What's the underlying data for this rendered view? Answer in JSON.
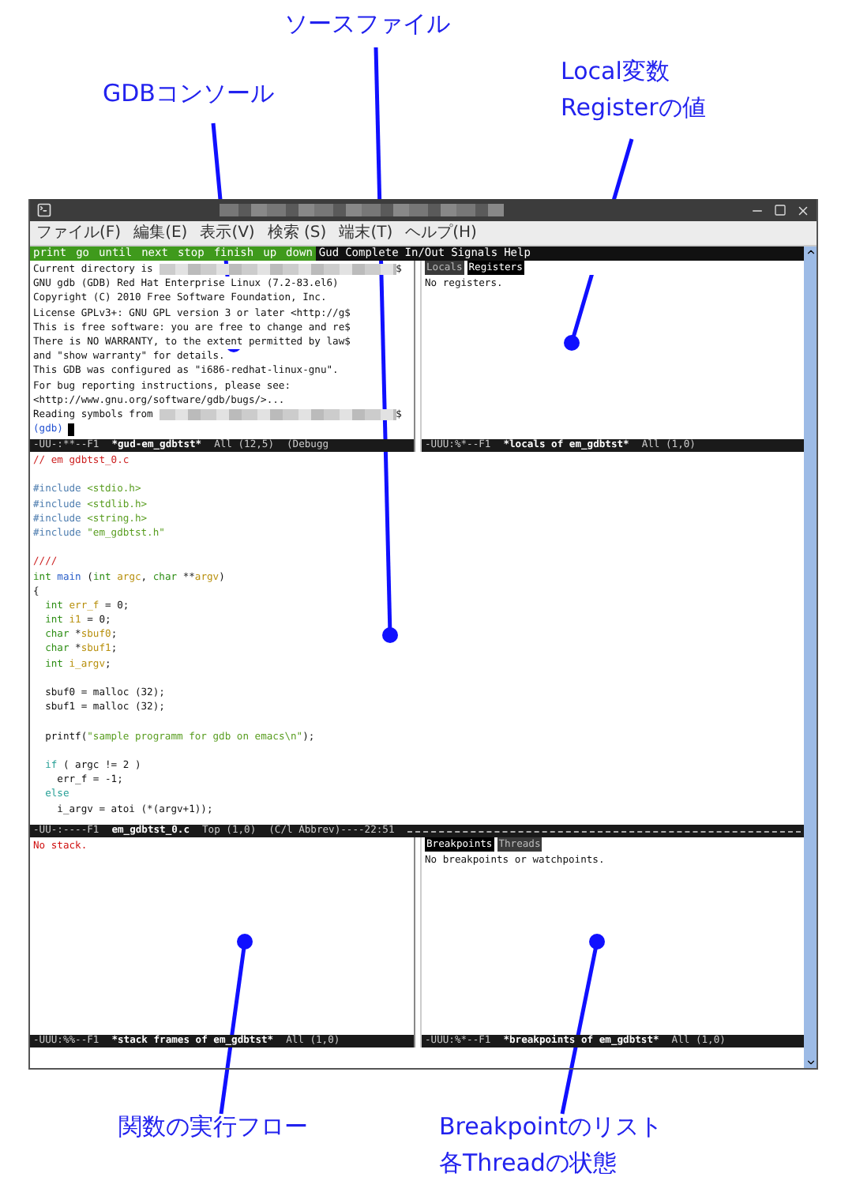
{
  "callouts": [
    {
      "lines": [
        "ソースファイル"
      ]
    },
    {
      "lines": [
        "GDBコンソール"
      ]
    },
    {
      "lines": [
        "Local変数",
        "Registerの値"
      ]
    },
    {
      "lines": [
        "関数の実行フロー"
      ]
    },
    {
      "lines": [
        "Breakpointのリスト",
        "各Threadの状態"
      ]
    }
  ],
  "window": {
    "menu": [
      "ファイル(F)",
      "編集(E)",
      "表示(V)",
      "検索 (S)",
      "端末(T)",
      "ヘルプ(H)"
    ]
  },
  "gud_toolbar": {
    "buttons": [
      "print",
      "go",
      "until",
      "next",
      "stop",
      "finish",
      "up",
      "down"
    ],
    "menus": [
      "Gud",
      "Complete",
      "In/Out",
      "Signals",
      "Help"
    ]
  },
  "gdb_console": {
    "lines": [
      {
        "kind": "output",
        "text": "Current directory is ",
        "redacted": true,
        "tail": "$"
      },
      {
        "kind": "output",
        "text": "GNU gdb (GDB) Red Hat Enterprise Linux (7.2-83.el6)",
        "redacted": false
      },
      {
        "kind": "output",
        "text": "Copyright (C) 2010 Free Software Foundation, Inc.",
        "redacted": false
      },
      {
        "kind": "output",
        "text": "License GPLv3+: GNU GPL version 3 or later <http://g$",
        "redacted": false
      },
      {
        "kind": "output",
        "text": "This is free software: you are free to change and re$",
        "redacted": false
      },
      {
        "kind": "output",
        "text": "There is NO WARRANTY, to the extent permitted by law$",
        "redacted": false
      },
      {
        "kind": "output",
        "text": "and \"show warranty\" for details.",
        "redacted": false
      },
      {
        "kind": "output",
        "text": "This GDB was configured as \"i686-redhat-linux-gnu\".",
        "redacted": false
      },
      {
        "kind": "output",
        "text": "For bug reporting instructions, please see:",
        "redacted": false
      },
      {
        "kind": "output",
        "text": "<http://www.gnu.org/software/gdb/bugs/>...",
        "redacted": false
      },
      {
        "kind": "output",
        "text": "Reading symbols from ",
        "redacted": true,
        "tail": "$"
      },
      {
        "kind": "prompt",
        "text": "(gdb)",
        "redacted": false
      }
    ],
    "mode_line": {
      "flags": "-UU-:**--F1",
      "buffer": "*gud-em_gdbtst*",
      "position": "All (12,5)",
      "extra": "(Debugg"
    }
  },
  "locals": {
    "tabs": [
      {
        "label": "Locals",
        "selected": false
      },
      {
        "label": "Registers",
        "selected": true
      }
    ],
    "message": "No registers.",
    "mode_line": {
      "flags": "-UUU:%*--F1",
      "buffer": "*locals of em_gdbtst*",
      "position": "All (1,0)"
    }
  },
  "source": {
    "lines": [
      {
        "kind": "code",
        "tokens": [
          {
            "kind": "comment",
            "text": "// em gdbtst_0.c"
          }
        ]
      },
      {
        "kind": "blank"
      },
      {
        "kind": "code",
        "tokens": [
          {
            "kind": "preproc",
            "text": "#include "
          },
          {
            "kind": "string",
            "text": "<stdio.h>"
          }
        ]
      },
      {
        "kind": "code",
        "tokens": [
          {
            "kind": "preproc",
            "text": "#include "
          },
          {
            "kind": "string",
            "text": "<stdlib.h>"
          }
        ]
      },
      {
        "kind": "code",
        "tokens": [
          {
            "kind": "preproc",
            "text": "#include "
          },
          {
            "kind": "string",
            "text": "<string.h>"
          }
        ]
      },
      {
        "kind": "code",
        "tokens": [
          {
            "kind": "preproc",
            "text": "#include "
          },
          {
            "kind": "string",
            "text": "\"em_gdbtst.h\""
          }
        ]
      },
      {
        "kind": "blank"
      },
      {
        "kind": "code",
        "tokens": [
          {
            "kind": "comment",
            "text": "////"
          }
        ]
      },
      {
        "kind": "code",
        "tokens": [
          {
            "kind": "type",
            "text": "int "
          },
          {
            "kind": "func",
            "text": "main"
          },
          {
            "kind": "plain",
            "text": " ("
          },
          {
            "kind": "type",
            "text": "int "
          },
          {
            "kind": "var",
            "text": "argc"
          },
          {
            "kind": "plain",
            "text": ", "
          },
          {
            "kind": "type",
            "text": "char"
          },
          {
            "kind": "plain",
            "text": " **"
          },
          {
            "kind": "var",
            "text": "argv"
          },
          {
            "kind": "plain",
            "text": ")"
          }
        ]
      },
      {
        "kind": "code",
        "tokens": [
          {
            "kind": "plain",
            "text": "{"
          }
        ]
      },
      {
        "kind": "code",
        "tokens": [
          {
            "kind": "type",
            "text": "  int "
          },
          {
            "kind": "var",
            "text": "err_f"
          },
          {
            "kind": "plain",
            "text": " = 0;"
          }
        ]
      },
      {
        "kind": "code",
        "tokens": [
          {
            "kind": "type",
            "text": "  int "
          },
          {
            "kind": "var",
            "text": "i1"
          },
          {
            "kind": "plain",
            "text": " = 0;"
          }
        ]
      },
      {
        "kind": "code",
        "tokens": [
          {
            "kind": "type",
            "text": "  char"
          },
          {
            "kind": "plain",
            "text": " *"
          },
          {
            "kind": "var",
            "text": "sbuf0"
          },
          {
            "kind": "plain",
            "text": ";"
          }
        ]
      },
      {
        "kind": "code",
        "tokens": [
          {
            "kind": "type",
            "text": "  char"
          },
          {
            "kind": "plain",
            "text": " *"
          },
          {
            "kind": "var",
            "text": "sbuf1"
          },
          {
            "kind": "plain",
            "text": ";"
          }
        ]
      },
      {
        "kind": "code",
        "tokens": [
          {
            "kind": "type",
            "text": "  int "
          },
          {
            "kind": "var",
            "text": "i_argv"
          },
          {
            "kind": "plain",
            "text": ";"
          }
        ]
      },
      {
        "kind": "blank"
      },
      {
        "kind": "code",
        "tokens": [
          {
            "kind": "plain",
            "text": "  sbuf0 = malloc (32);"
          }
        ]
      },
      {
        "kind": "code",
        "tokens": [
          {
            "kind": "plain",
            "text": "  sbuf1 = malloc (32);"
          }
        ]
      },
      {
        "kind": "blank"
      },
      {
        "kind": "code",
        "tokens": [
          {
            "kind": "plain",
            "text": "  printf("
          },
          {
            "kind": "string",
            "text": "\"sample programm for gdb on emacs\\n\""
          },
          {
            "kind": "plain",
            "text": ");"
          }
        ]
      },
      {
        "kind": "blank"
      },
      {
        "kind": "code",
        "tokens": [
          {
            "kind": "keyword",
            "text": "  if"
          },
          {
            "kind": "plain",
            "text": " ( argc != 2 )"
          }
        ]
      },
      {
        "kind": "code",
        "tokens": [
          {
            "kind": "plain",
            "text": "    err_f = -1;"
          }
        ]
      },
      {
        "kind": "code",
        "tokens": [
          {
            "kind": "keyword",
            "text": "  else"
          }
        ]
      },
      {
        "kind": "code",
        "tokens": [
          {
            "kind": "plain",
            "text": "    i_argv = atoi (*(argv+1));"
          }
        ]
      }
    ],
    "mode_line": {
      "flags": "-UU-:----F1",
      "buffer": "em_gdbtst_0.c",
      "position": "Top (1,0)",
      "extra": "(C/l Abbrev)----22:51"
    }
  },
  "stack": {
    "message": "No stack.",
    "mode_line": {
      "flags": "-UUU:%%--F1",
      "buffer": "*stack frames of em_gdbtst*",
      "position": "All (1,0)"
    }
  },
  "breakpoints": {
    "tabs": [
      {
        "label": "Breakpoints",
        "selected": true
      },
      {
        "label": "Threads",
        "selected": false
      }
    ],
    "message": "No breakpoints or watchpoints.",
    "mode_line": {
      "flags": "-UUU:%*--F1",
      "buffer": "*breakpoints of em_gdbtst*",
      "position": "All (1,0)"
    }
  }
}
